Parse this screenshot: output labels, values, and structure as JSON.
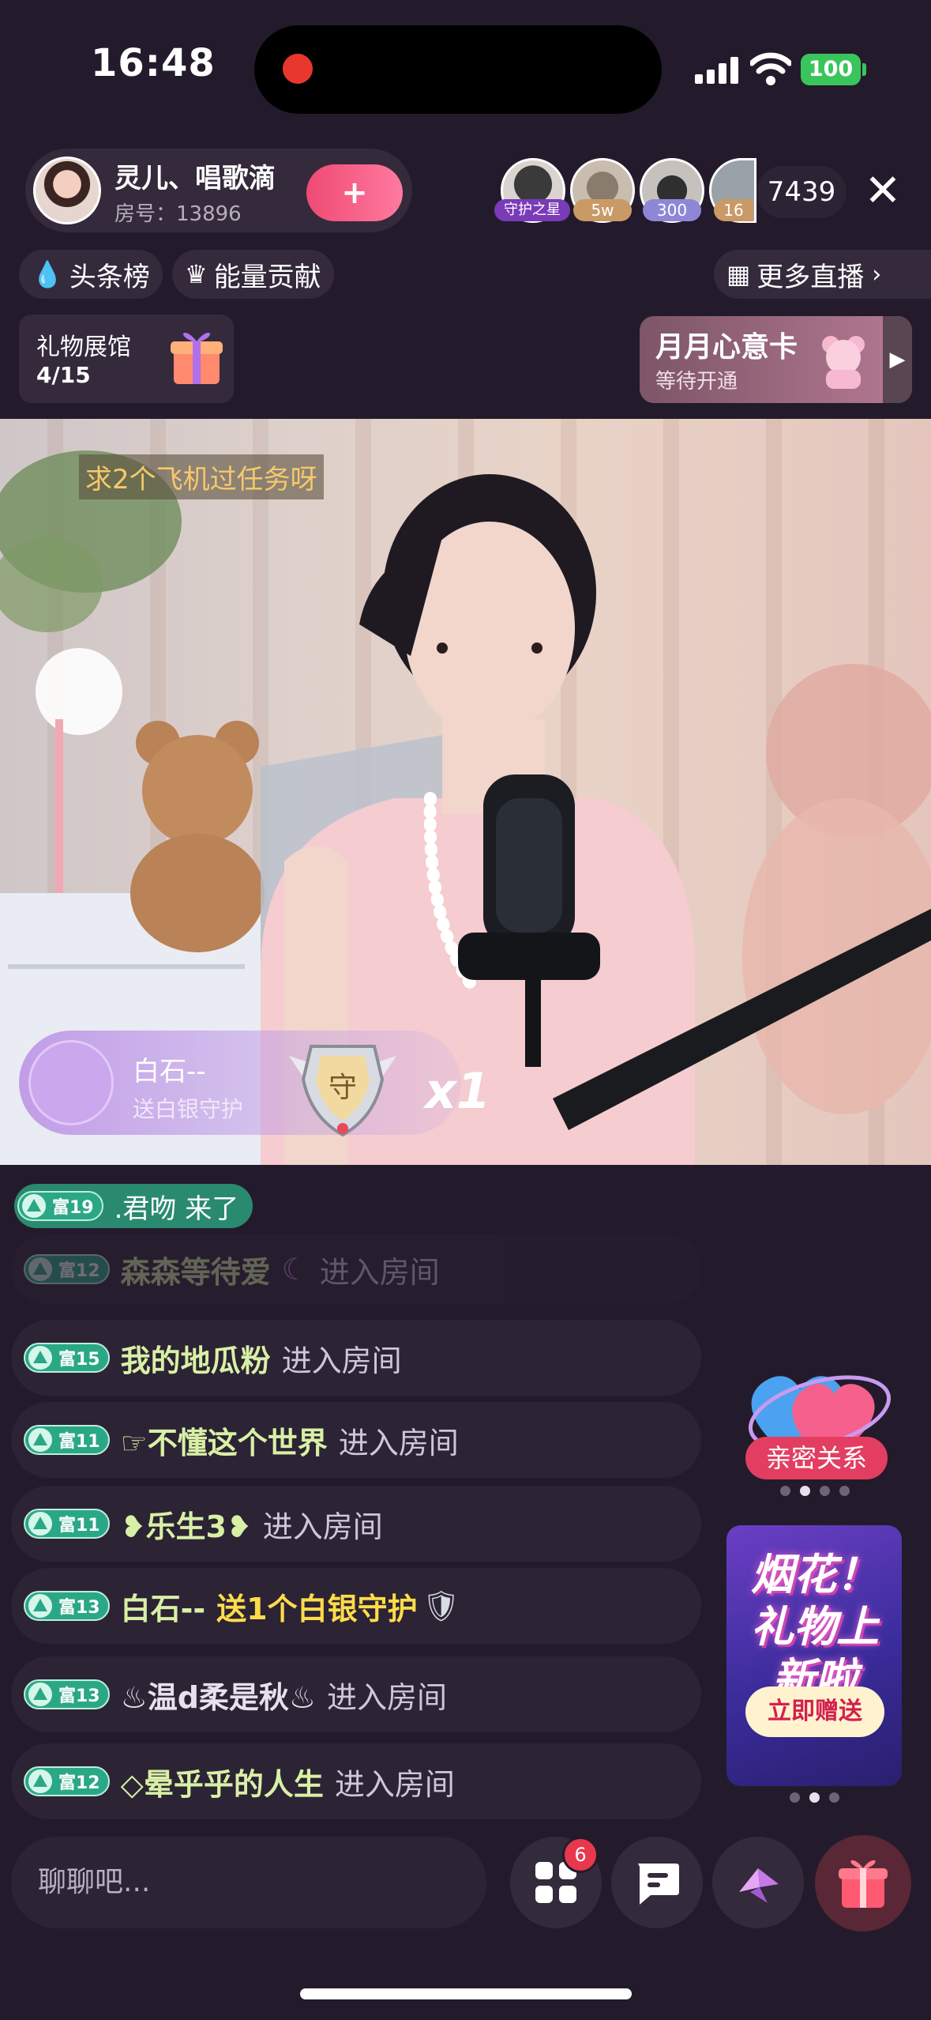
{
  "status_bar": {
    "time": "16:48",
    "battery": "100"
  },
  "host": {
    "name": "灵儿、唱歌滴",
    "room_number": "房号：13896"
  },
  "viewers": [
    {
      "tag": "守护之星"
    },
    {
      "tag": "5w"
    },
    {
      "tag": "300"
    },
    {
      "tag": "16"
    }
  ],
  "online_count": "7439",
  "chips": {
    "headline": "头条榜",
    "energy": "能量贡献",
    "more_live": "更多直播"
  },
  "gift_hall": {
    "title": "礼物展馆",
    "count": "4/15"
  },
  "card_banner": {
    "title": "月月心意卡",
    "subtitle": "等待开通"
  },
  "video": {
    "caption": "求2个飞机过任务呀"
  },
  "gift_toast": {
    "sender": "白石--",
    "gift": "送白银守护",
    "badge_char": "守",
    "multiplier": "x1"
  },
  "chat": {
    "notice": {
      "level": "富19",
      "text": ".君吻 来了"
    },
    "messages": [
      {
        "level": "富12",
        "user": "森森等待爱",
        "action": "进入房间"
      },
      {
        "level": "富15",
        "user": "我的地瓜粉",
        "action": "进入房间"
      },
      {
        "level": "富11",
        "user": "☞不懂这个世界",
        "action": "进入房间"
      },
      {
        "level": "富11",
        "user": "❥乐生3❥",
        "action": "进入房间"
      },
      {
        "level": "富13",
        "user": "白石--",
        "action": "送1个白银守护"
      },
      {
        "level": "富13",
        "user": "♨温d柔是秋♨",
        "action": "进入房间"
      },
      {
        "level": "富12",
        "user": "◇晕乎乎的人生",
        "action": "进入房间"
      }
    ]
  },
  "side": {
    "intimacy_label": "亲密关系",
    "promo_title": "烟花！礼物上新啦",
    "promo_button": "立即赠送"
  },
  "bottom": {
    "input_placeholder": "聊聊吧...",
    "apps_badge": "6"
  },
  "colors": {
    "bg": "#231b2b",
    "accent": "#ef4a73",
    "level_badge": "#2aa886",
    "username": "#d8f0a6",
    "gift_text": "#ffdc4a"
  }
}
